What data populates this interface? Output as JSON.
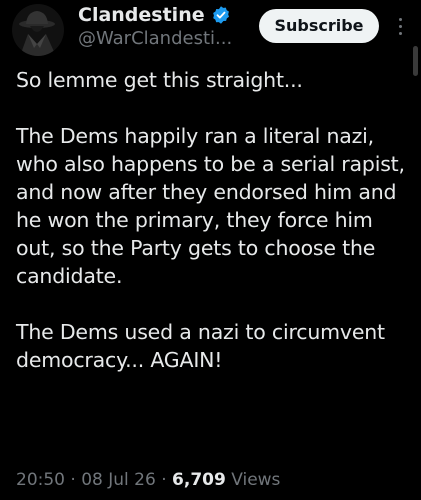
{
  "author": {
    "display_name": "Clandestine",
    "handle": "@WarClandesti...",
    "verified": true,
    "verified_color": "#1d9bf0"
  },
  "actions": {
    "subscribe_label": "Subscribe",
    "more_icon": "more-vertical-icon"
  },
  "tweet": {
    "paragraphs": [
      "So lemme get this straight...",
      "The Dems happily ran a literal nazi, who also happens to be a serial rapist, and now after they endorsed him and he won the primary, they force him out, so the Party gets to choose the candidate.",
      "The Dems used a nazi to circumvent democracy... AGAIN!"
    ]
  },
  "meta": {
    "time": "20:50",
    "separator": "·",
    "date": "08 Jul 26",
    "views_count": "6,709",
    "views_label": "Views"
  },
  "theme": {
    "background": "#000000",
    "text": "#e7e9ea",
    "muted": "#71767b"
  }
}
